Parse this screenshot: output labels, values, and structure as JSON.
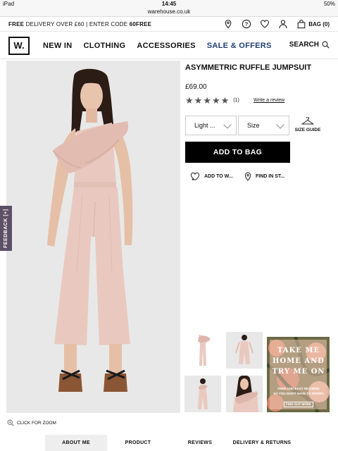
{
  "status_bar": {
    "device": "iPad",
    "time": "14:45",
    "battery": "50%"
  },
  "browser": {
    "url": "warehouse.co.uk"
  },
  "promo": {
    "prefix": "FREE",
    "text": " DELIVERY OVER £60 | ENTER CODE ",
    "code": "60FREE"
  },
  "header": {
    "bag_label": "BAG (0)",
    "icons": [
      "location-pin-icon",
      "help-icon",
      "heart-icon",
      "user-icon",
      "bag-icon"
    ]
  },
  "nav": {
    "logo": "W.",
    "items": [
      {
        "label": "NEW IN"
      },
      {
        "label": "CLOTHING"
      },
      {
        "label": "ACCESSORIES"
      },
      {
        "label": "SALE & OFFERS"
      }
    ],
    "search_label": "SEARCH"
  },
  "feedback": {
    "label": "FEEDBACK [+]"
  },
  "product": {
    "title": "ASYMMETRIC RUFFLE JUMPSUIT",
    "price": "£69.00",
    "rating": 5,
    "stars": [
      "★",
      "★",
      "★",
      "★",
      "★"
    ],
    "review_count": "(1)",
    "write_review": "Write a review",
    "colour_select": "Light ...",
    "size_select": "Size",
    "size_guide": "SIZE GUIDE",
    "add_to_bag": "ADD TO BAG",
    "wishlist": "ADD TO W...",
    "find_in_store": "FIND IN ST..."
  },
  "promo_tile": {
    "headline_1": "TAKE ME",
    "headline_2": "HOME AND",
    "headline_3": "TRY ME ON",
    "sub_1": "FREE AND EASY RETURNS",
    "sub_2": "SO YOU DON'T HAVE TO WORRY",
    "button": "FIND OUT MORE"
  },
  "zoom_label": "CLICK FOR ZOOM",
  "tabs": [
    {
      "label": "ABOUT ME",
      "active": true
    },
    {
      "label": "PRODUCT INFORMATION",
      "active": false
    },
    {
      "label": "REVIEWS",
      "active": false
    },
    {
      "label": "DELIVERY & RETURNS",
      "active": false
    }
  ],
  "colors": {
    "sale": "#1f3f78",
    "feedback": "#5c5066",
    "product": "#e9c9bf"
  }
}
